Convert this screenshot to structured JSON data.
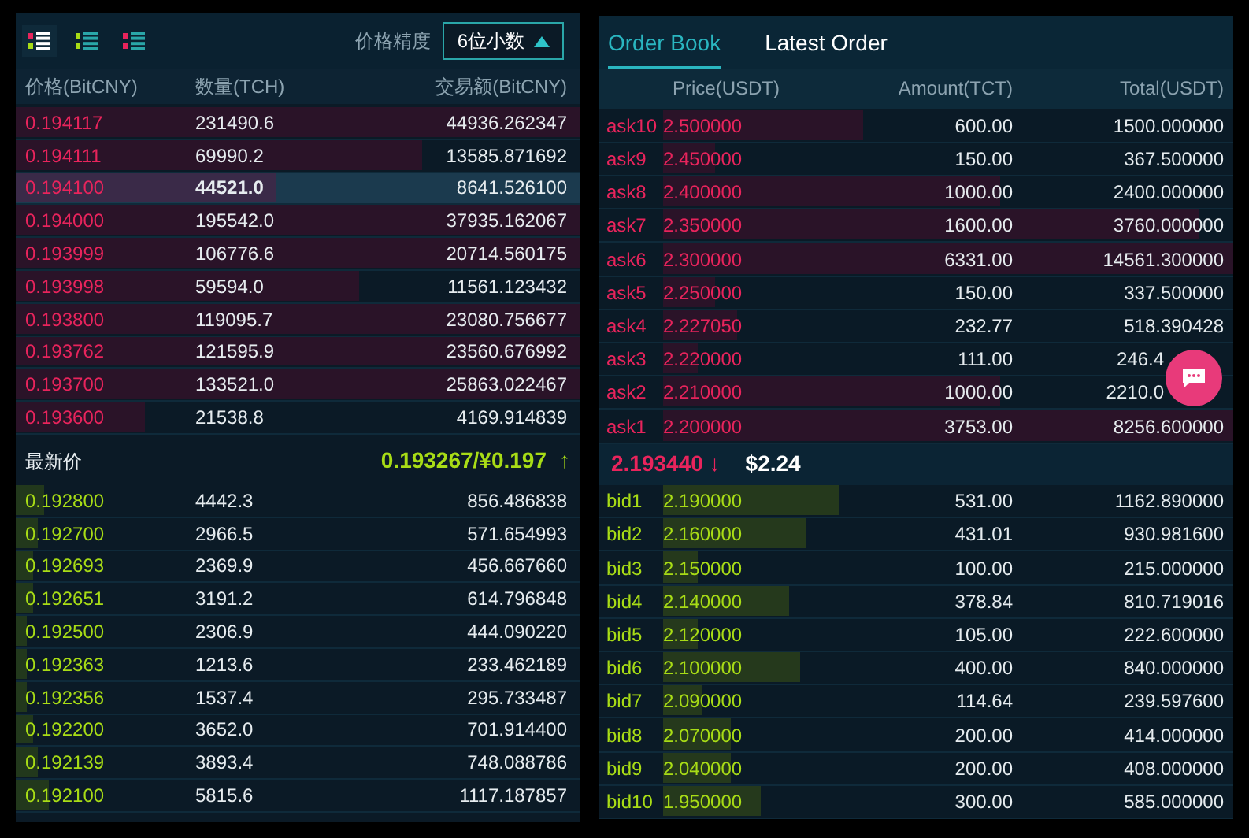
{
  "left_panel": {
    "view_tabs": [
      {
        "kind": "all",
        "selected": true
      },
      {
        "kind": "bids",
        "selected": false
      },
      {
        "kind": "asks",
        "selected": false
      }
    ],
    "precision": {
      "label": "价格精度",
      "value": "6位小数",
      "expanded": true
    },
    "columns": [
      "价格(BitCNY)",
      "数量(TCH)",
      "交易额(BitCNY)"
    ],
    "asks": [
      {
        "price": "0.194117",
        "amount": "231490.6",
        "total": "44936.262347",
        "level": 1.0,
        "selected": false
      },
      {
        "price": "0.194111",
        "amount": "69990.2",
        "total": "13585.871692",
        "level": 0.72,
        "selected": false
      },
      {
        "price": "0.194100",
        "amount": "44521.0",
        "total": "8641.526100",
        "level": 0.46,
        "selected": true
      },
      {
        "price": "0.194000",
        "amount": "195542.0",
        "total": "37935.162067",
        "level": 1.0,
        "selected": false
      },
      {
        "price": "0.193999",
        "amount": "106776.6",
        "total": "20714.560175",
        "level": 1.0,
        "selected": false
      },
      {
        "price": "0.193998",
        "amount": "59594.0",
        "total": "11561.123432",
        "level": 0.61,
        "selected": false
      },
      {
        "price": "0.193800",
        "amount": "119095.7",
        "total": "23080.756677",
        "level": 1.0,
        "selected": false
      },
      {
        "price": "0.193762",
        "amount": "121595.9",
        "total": "23560.676992",
        "level": 1.0,
        "selected": false
      },
      {
        "price": "0.193700",
        "amount": "133521.0",
        "total": "25863.022467",
        "level": 1.0,
        "selected": false
      },
      {
        "price": "0.193600",
        "amount": "21538.8",
        "total": "4169.914839",
        "level": 0.23,
        "selected": false
      }
    ],
    "last_price": {
      "label": "最新价",
      "value": "0.193267/¥0.197",
      "trend": "↑"
    },
    "bids": [
      {
        "price": "0.192800",
        "amount": "4442.3",
        "total": "856.486838",
        "level": 0.05
      },
      {
        "price": "0.192700",
        "amount": "2966.5",
        "total": "571.654993",
        "level": 0.04
      },
      {
        "price": "0.192693",
        "amount": "2369.9",
        "total": "456.667660",
        "level": 0.03
      },
      {
        "price": "0.192651",
        "amount": "3191.2",
        "total": "614.796848",
        "level": 0.03
      },
      {
        "price": "0.192500",
        "amount": "2306.9",
        "total": "444.090220",
        "level": 0.02
      },
      {
        "price": "0.192363",
        "amount": "1213.6",
        "total": "233.462189",
        "level": 0.02
      },
      {
        "price": "0.192356",
        "amount": "1537.4",
        "total": "295.733487",
        "level": 0.02
      },
      {
        "price": "0.192200",
        "amount": "3652.0",
        "total": "701.914400",
        "level": 0.03
      },
      {
        "price": "0.192139",
        "amount": "3893.4",
        "total": "748.088786",
        "level": 0.04
      },
      {
        "price": "0.192100",
        "amount": "5815.6",
        "total": "1117.187857",
        "level": 0.06
      }
    ]
  },
  "right_panel": {
    "tabs": [
      {
        "label": "Order Book",
        "selected": true
      },
      {
        "label": "Latest Order",
        "selected": false
      }
    ],
    "columns": [
      "Price(USDT)",
      "Amount(TCT)",
      "Total(USDT)"
    ],
    "asks": [
      {
        "label": "ask10",
        "price": "2.500000",
        "amount": "600.00",
        "total": "1500.000000",
        "level": 0.35
      },
      {
        "label": "ask9",
        "price": "2.450000",
        "amount": "150.00",
        "total": "367.500000",
        "level": 0.09
      },
      {
        "label": "ask8",
        "price": "2.400000",
        "amount": "1000.00",
        "total": "2400.000000",
        "level": 0.59
      },
      {
        "label": "ask7",
        "price": "2.350000",
        "amount": "1600.00",
        "total": "3760.000000",
        "level": 0.94
      },
      {
        "label": "ask6",
        "price": "2.300000",
        "amount": "6331.00",
        "total": "14561.300000",
        "level": 1.0
      },
      {
        "label": "ask5",
        "price": "2.250000",
        "amount": "150.00",
        "total": "337.500000",
        "level": 0.09
      },
      {
        "label": "ask4",
        "price": "2.227050",
        "amount": "232.77",
        "total": "518.390428",
        "level": 0.13
      },
      {
        "label": "ask3",
        "price": "2.220000",
        "amount": "111.00",
        "total": "246.4",
        "level": 0.06
      },
      {
        "label": "ask2",
        "price": "2.210000",
        "amount": "1000.00",
        "total": "2210.0",
        "level": 0.59
      },
      {
        "label": "ask1",
        "price": "2.200000",
        "amount": "3753.00",
        "total": "8256.600000",
        "level": 1.0
      }
    ],
    "last_price": {
      "value": "2.193440",
      "trend": "↓",
      "usd": "$2.24"
    },
    "bids": [
      {
        "label": "bid1",
        "price": "2.190000",
        "amount": "531.00",
        "total": "1162.890000",
        "level": 0.31
      },
      {
        "label": "bid2",
        "price": "2.160000",
        "amount": "431.01",
        "total": "930.981600",
        "level": 0.25
      },
      {
        "label": "bid3",
        "price": "2.150000",
        "amount": "100.00",
        "total": "215.000000",
        "level": 0.06
      },
      {
        "label": "bid4",
        "price": "2.140000",
        "amount": "378.84",
        "total": "810.719016",
        "level": 0.22
      },
      {
        "label": "bid5",
        "price": "2.120000",
        "amount": "105.00",
        "total": "222.600000",
        "level": 0.06
      },
      {
        "label": "bid6",
        "price": "2.100000",
        "amount": "400.00",
        "total": "840.000000",
        "level": 0.24
      },
      {
        "label": "bid7",
        "price": "2.090000",
        "amount": "114.64",
        "total": "239.597600",
        "level": 0.07
      },
      {
        "label": "bid8",
        "price": "2.070000",
        "amount": "200.00",
        "total": "414.000000",
        "level": 0.12
      },
      {
        "label": "bid9",
        "price": "2.040000",
        "amount": "200.00",
        "total": "408.000000",
        "level": 0.12
      },
      {
        "label": "bid10",
        "price": "1.950000",
        "amount": "300.00",
        "total": "585.000000",
        "level": 0.17
      }
    ]
  }
}
